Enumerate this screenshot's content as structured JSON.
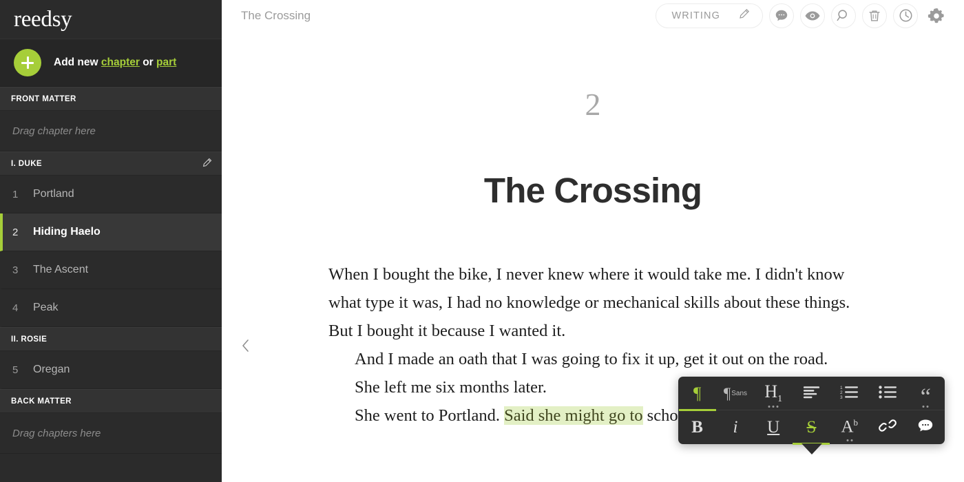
{
  "sidebar": {
    "brand": "reedsy",
    "add_new": {
      "prefix": "Add new ",
      "chapter_link": "chapter",
      "middle": " or ",
      "part_link": "part"
    },
    "sections": [
      {
        "header": "FRONT MATTER",
        "editable": false,
        "placeholder": "Drag chapter here",
        "chapters": []
      },
      {
        "header": "I. DUKE",
        "editable": true,
        "placeholder": null,
        "chapters": [
          {
            "num": "1",
            "title": "Portland",
            "active": false
          },
          {
            "num": "2",
            "title": "Hiding Haelo",
            "active": true
          },
          {
            "num": "3",
            "title": "The Ascent",
            "active": false
          },
          {
            "num": "4",
            "title": "Peak",
            "active": false
          }
        ]
      },
      {
        "header": "II. ROSIE",
        "editable": false,
        "placeholder": null,
        "chapters": [
          {
            "num": "5",
            "title": "Oregan",
            "active": false
          }
        ]
      },
      {
        "header": "BACK MATTER",
        "editable": false,
        "placeholder": "Drag chapters here",
        "chapters": []
      }
    ]
  },
  "topbar": {
    "breadcrumb": "The Crossing",
    "status_label": "WRITING",
    "icons": [
      "comment-icon",
      "eye-icon",
      "search-icon",
      "trash-icon",
      "history-icon",
      "gear-icon"
    ]
  },
  "document": {
    "chapter_number": "2",
    "chapter_title": "The Crossing",
    "paragraphs": [
      {
        "indent": false,
        "runs": [
          {
            "text": "When I bought the bike, I never knew where it would take me. I didn't know what type it was, I had no knowledge or mechanical skills about these things. But I bought it because I wanted it.",
            "highlight": false
          }
        ]
      },
      {
        "indent": true,
        "runs": [
          {
            "text": "And I made an oath that I was going to fix it up, get it out on the road.",
            "highlight": false
          }
        ]
      },
      {
        "indent": true,
        "runs": [
          {
            "text": "She left me six months later.",
            "highlight": false
          }
        ]
      },
      {
        "indent": true,
        "runs": [
          {
            "text": "She went to Portland. ",
            "highlight": false
          },
          {
            "text": "Said she might go to",
            "highlight": true
          },
          {
            "text": " school out there or get a",
            "highlight": false
          }
        ]
      }
    ]
  },
  "format_toolbar": {
    "row1": [
      {
        "name": "paragraph-style",
        "glyph": "¶",
        "active": true,
        "dots": 0,
        "sublabel": ""
      },
      {
        "name": "font-family",
        "glyph": "¶",
        "active": false,
        "dots": 0,
        "sublabel": "Sans"
      },
      {
        "name": "heading-h1",
        "glyph": "H",
        "active": false,
        "dots": 3,
        "sublabel": "1"
      },
      {
        "name": "align",
        "glyph": "",
        "active": false,
        "dots": 0,
        "sublabel": ""
      },
      {
        "name": "ordered-list",
        "glyph": "",
        "active": false,
        "dots": 0,
        "sublabel": ""
      },
      {
        "name": "bullet-list",
        "glyph": "",
        "active": false,
        "dots": 0,
        "sublabel": ""
      },
      {
        "name": "blockquote",
        "glyph": "“",
        "active": false,
        "dots": 2,
        "sublabel": ""
      }
    ],
    "row2": [
      {
        "name": "bold",
        "glyph": "B",
        "active": false,
        "dots": 0
      },
      {
        "name": "italic",
        "glyph": "i",
        "active": false,
        "dots": 0
      },
      {
        "name": "underline",
        "glyph": "U",
        "active": false,
        "dots": 0
      },
      {
        "name": "strikethrough",
        "glyph": "S",
        "active": true,
        "dots": 0
      },
      {
        "name": "text-color",
        "glyph": "A",
        "active": false,
        "dots": 2,
        "sup": "b"
      },
      {
        "name": "link",
        "glyph": "",
        "active": false,
        "dots": 0
      },
      {
        "name": "comment",
        "glyph": "",
        "active": false,
        "dots": 0
      }
    ]
  },
  "colors": {
    "accent_green": "#a6ce39",
    "sidebar_bg": "#2b2b2b",
    "section_header_bg": "#333333",
    "active_item_bg": "#383838",
    "highlight_green": "#e3f0c5",
    "toolbar_bg": "#2e2e2e"
  }
}
